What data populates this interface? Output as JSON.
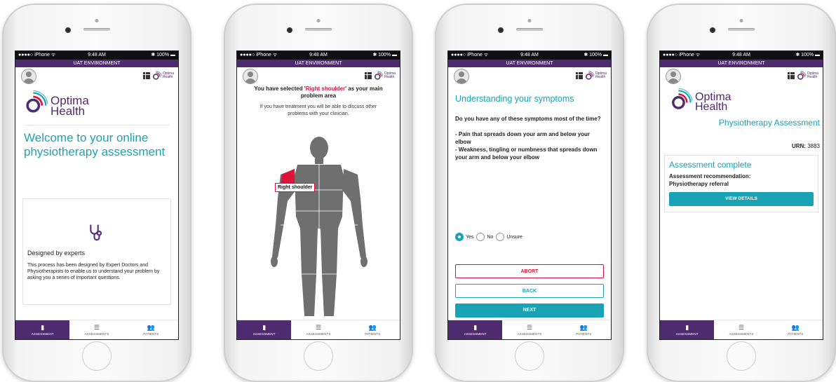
{
  "status_bar": {
    "carrier": "●●●●○ iPhone ᯤ",
    "time": "9:48 AM",
    "battery": "✱ 100% ▬"
  },
  "env_banner": "UAT ENVIRONMENT",
  "logo": {
    "name_line1": "Optima",
    "name_line2": "Health"
  },
  "tabs": {
    "assessment": "ASSESSMENT",
    "assessments": "ASSESSMENTS",
    "patients": "PATIENTS"
  },
  "icons": {
    "tab_assessment": "clipboard-icon",
    "tab_assessments": "list-icon",
    "tab_patients": "people-icon",
    "apps": "grid-icon",
    "profile": "avatar-icon",
    "card": "stethoscope-icon"
  },
  "colors": {
    "purple": "#4e2a6e",
    "teal": "#1aa3b5",
    "red": "#e0103b"
  },
  "screen1": {
    "welcome_title": "Welcome to your online physiotherapy assessment",
    "card_title": "Designed by experts",
    "card_body": "This process has been designed by Expert Doctors and Physiotherapists to enable us to understand your problem by asking you a series of important questions."
  },
  "screen2": {
    "selected_prefix": "You have selected '",
    "selected_area": "Right shoulder",
    "selected_suffix": "' as your main problem area",
    "info": "If you have treatment you will be able to discuss other problems with your clinician.",
    "body_label": "Right shoulder"
  },
  "screen3": {
    "title": "Understanding your symptoms",
    "question": "Do you have any of these symptoms most of the time?",
    "symptom1": "- Pain that spreads down your arm and below your elbow",
    "symptom2": "- Weakness, tingling or numbness that spreads down your arm and below your elbow",
    "options": [
      "Yes",
      "No",
      "Unsure"
    ],
    "selected_option": "Yes",
    "abort": "ABORT",
    "back": "BACK",
    "next": "NEXT"
  },
  "screen4": {
    "assessment_title": "Physiotherapy Assessment",
    "urn_label": "URN:",
    "urn_value": "3883",
    "complete_title": "Assessment complete",
    "recommendation": "Assessment recommendation: Physiotherapy referral",
    "view_details": "VIEW DETAILS"
  }
}
